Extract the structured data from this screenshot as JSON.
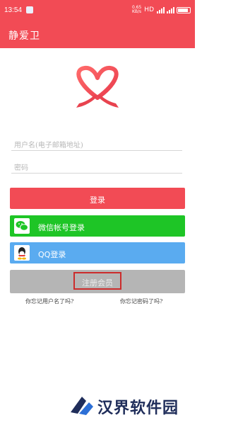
{
  "status_bar": {
    "time": "13:54",
    "network_speed": "0.65\nKB/s",
    "hd_label": "HD",
    "battery_icon": "battery-icon"
  },
  "app_bar": {
    "title": "静爱卫"
  },
  "logo": {
    "icon": "heart-ribbon-logo"
  },
  "form": {
    "username_placeholder": "用户名(电子邮箱地址)",
    "password_placeholder": "密码"
  },
  "buttons": {
    "login": "登录",
    "wechat_login": "微信帐号登录",
    "qq_login": "QQ登录",
    "register": "注册会员"
  },
  "links": {
    "forgot_username": "你忘记用户名了吗?",
    "forgot_password": "你忘记密码了吗?"
  },
  "watermark": {
    "text": "汉界软件园"
  },
  "colors": {
    "brand": "#f24b55",
    "wechat": "#1ec526",
    "qq": "#5aabf0",
    "register": "#b5b5b5",
    "highlight": "#cc2c2c"
  }
}
